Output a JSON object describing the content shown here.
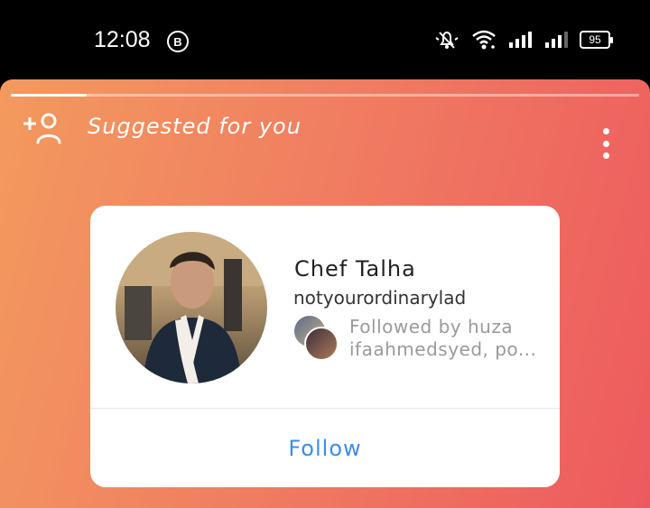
{
  "status_bar": {
    "time": "12:08",
    "business_badge": "B",
    "battery_level": "95"
  },
  "story": {
    "progress_fraction": 0.12,
    "suggest_label": "Suggested for you"
  },
  "card": {
    "name": "Chef Talha",
    "username": "notyourordinarylad",
    "followed_by_line1": "Followed by huza",
    "followed_by_line2": "ifaahmedsyed, po...",
    "follow_label": "Follow"
  },
  "colors": {
    "gradient_left": "#f39a5e",
    "gradient_right": "#ed5a5e",
    "follow_blue": "#3d8de6"
  }
}
